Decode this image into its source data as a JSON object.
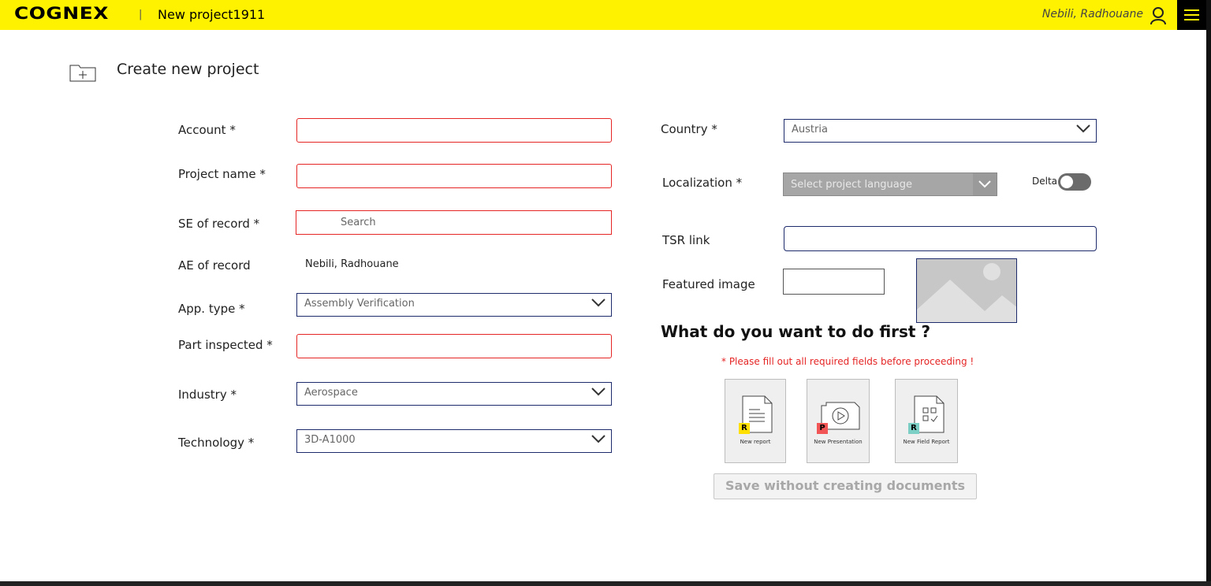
{
  "topbar": {
    "logo": "COGNEX",
    "separator": "|",
    "project_title": "New project1911",
    "user_name": "Nebili, Radhouane",
    "brand_color": "#fff200"
  },
  "header": {
    "title": "Create new project"
  },
  "form_left": {
    "account": {
      "label": "Account *",
      "value": ""
    },
    "project_name": {
      "label": "Project name *",
      "value": ""
    },
    "se_of_record": {
      "label": "SE of record *",
      "placeholder": "Search"
    },
    "ae_of_record": {
      "label": "AE of record",
      "value": "Nebili, Radhouane"
    },
    "app_type": {
      "label": "App. type *",
      "value": "Assembly Verification"
    },
    "part_inspected": {
      "label": "Part inspected *",
      "value": ""
    },
    "industry": {
      "label": "Industry *",
      "value": "Aerospace"
    },
    "technology": {
      "label": "Technology *",
      "value": "3D-A1000"
    }
  },
  "form_right": {
    "country": {
      "label": "Country *",
      "value": "Austria"
    },
    "localization": {
      "label": "Localization *",
      "placeholder": "Select project language"
    },
    "delta_toggle": {
      "label": "Delta",
      "on": false
    },
    "tsr_link": {
      "label": "TSR link",
      "value": ""
    },
    "featured_image": {
      "label": "Featured image"
    }
  },
  "first_actions": {
    "title": "What do you want to do first ?",
    "warning": "* Please fill out all required fields before proceeding !",
    "cards": [
      {
        "badge": "R",
        "label": "New report",
        "badge_color": "#ffe000"
      },
      {
        "badge": "P",
        "label": "New Presentation",
        "badge_color": "#f25555"
      },
      {
        "badge": "R",
        "label": "New Field Report",
        "badge_color": "#7ccfc4"
      }
    ],
    "save_label": "Save without creating documents"
  },
  "colors": {
    "error_border": "#e52424",
    "field_border": "#1d2a6b"
  }
}
